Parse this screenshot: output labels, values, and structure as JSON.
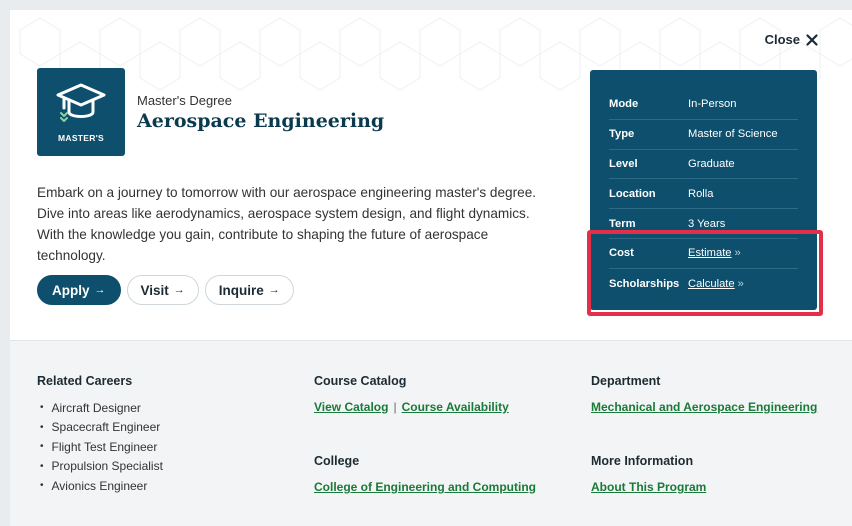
{
  "close": {
    "label": "Close"
  },
  "badge": {
    "label": "MASTER'S"
  },
  "program": {
    "degree_type": "Master's Degree",
    "title": "Aerospace Engineering",
    "description": "Embark on a journey to tomorrow with our aerospace engineering master's degree. Dive into areas like aerodynamics, aerospace system design, and flight dynamics. With the knowledge you gain, contribute to shaping the future of aerospace technology."
  },
  "actions": {
    "apply": "Apply",
    "visit": "Visit",
    "inquire": "Inquire",
    "arrow": "→"
  },
  "info": {
    "mode_key": "Mode",
    "mode_val": "In-Person",
    "type_key": "Type",
    "type_val": "Master of Science",
    "level_key": "Level",
    "level_val": "Graduate",
    "location_key": "Location",
    "location_val": "Rolla",
    "term_key": "Term",
    "term_val": "3 Years",
    "cost_key": "Cost",
    "cost_link": "Estimate",
    "scholarships_key": "Scholarships",
    "scholarships_link": "Calculate",
    "more_glyph": "»"
  },
  "related_careers": {
    "heading": "Related Careers",
    "items": [
      "Aircraft Designer",
      "Spacecraft Engineer",
      "Flight Test Engineer",
      "Propulsion Specialist",
      "Avionics Engineer"
    ]
  },
  "course_catalog": {
    "heading": "Course Catalog",
    "view_catalog": "View Catalog",
    "separator": "|",
    "course_availability": "Course Availability"
  },
  "college": {
    "heading": "College",
    "link": "College of Engineering and Computing"
  },
  "department": {
    "heading": "Department",
    "link": "Mechanical and Aerospace Engineering"
  },
  "more_information": {
    "heading": "More Information",
    "link": "About This Program"
  },
  "colors": {
    "brand_teal": "#0d4f6c",
    "link_green": "#1a7a3a",
    "highlight_red": "#e2304a"
  }
}
